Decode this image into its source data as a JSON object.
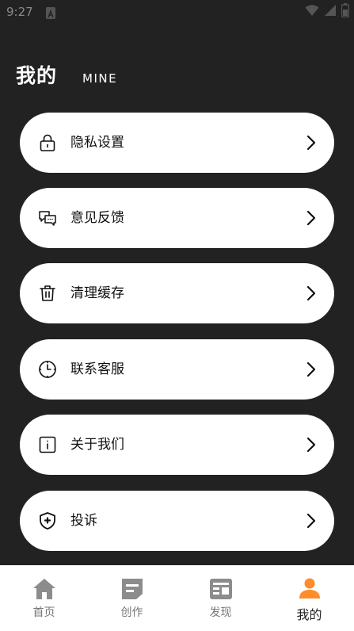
{
  "status_bar": {
    "time": "9:27",
    "icons": [
      "notification-a-icon",
      "wifi-icon",
      "cell-signal-icon",
      "battery-icon"
    ]
  },
  "header": {
    "title": "我的",
    "subtitle": "MINE"
  },
  "menu": {
    "items": [
      {
        "label": "隐私设置",
        "icon": "lock-icon"
      },
      {
        "label": "意见反馈",
        "icon": "chat-bubbles-icon"
      },
      {
        "label": "清理缓存",
        "icon": "trash-icon"
      },
      {
        "label": "联系客服",
        "icon": "clock-icon"
      },
      {
        "label": "关于我们",
        "icon": "info-icon"
      },
      {
        "label": "投诉",
        "icon": "shield-plus-icon"
      }
    ]
  },
  "bottom_nav": {
    "items": [
      {
        "label": "首页",
        "icon": "home-icon",
        "active": false
      },
      {
        "label": "创作",
        "icon": "create-icon",
        "active": false
      },
      {
        "label": "发现",
        "icon": "discover-icon",
        "active": false
      },
      {
        "label": "我的",
        "icon": "person-icon",
        "active": true
      }
    ],
    "colors": {
      "inactive_icon": "#8c8c8c",
      "active_icon": "#ff8c2a"
    }
  }
}
